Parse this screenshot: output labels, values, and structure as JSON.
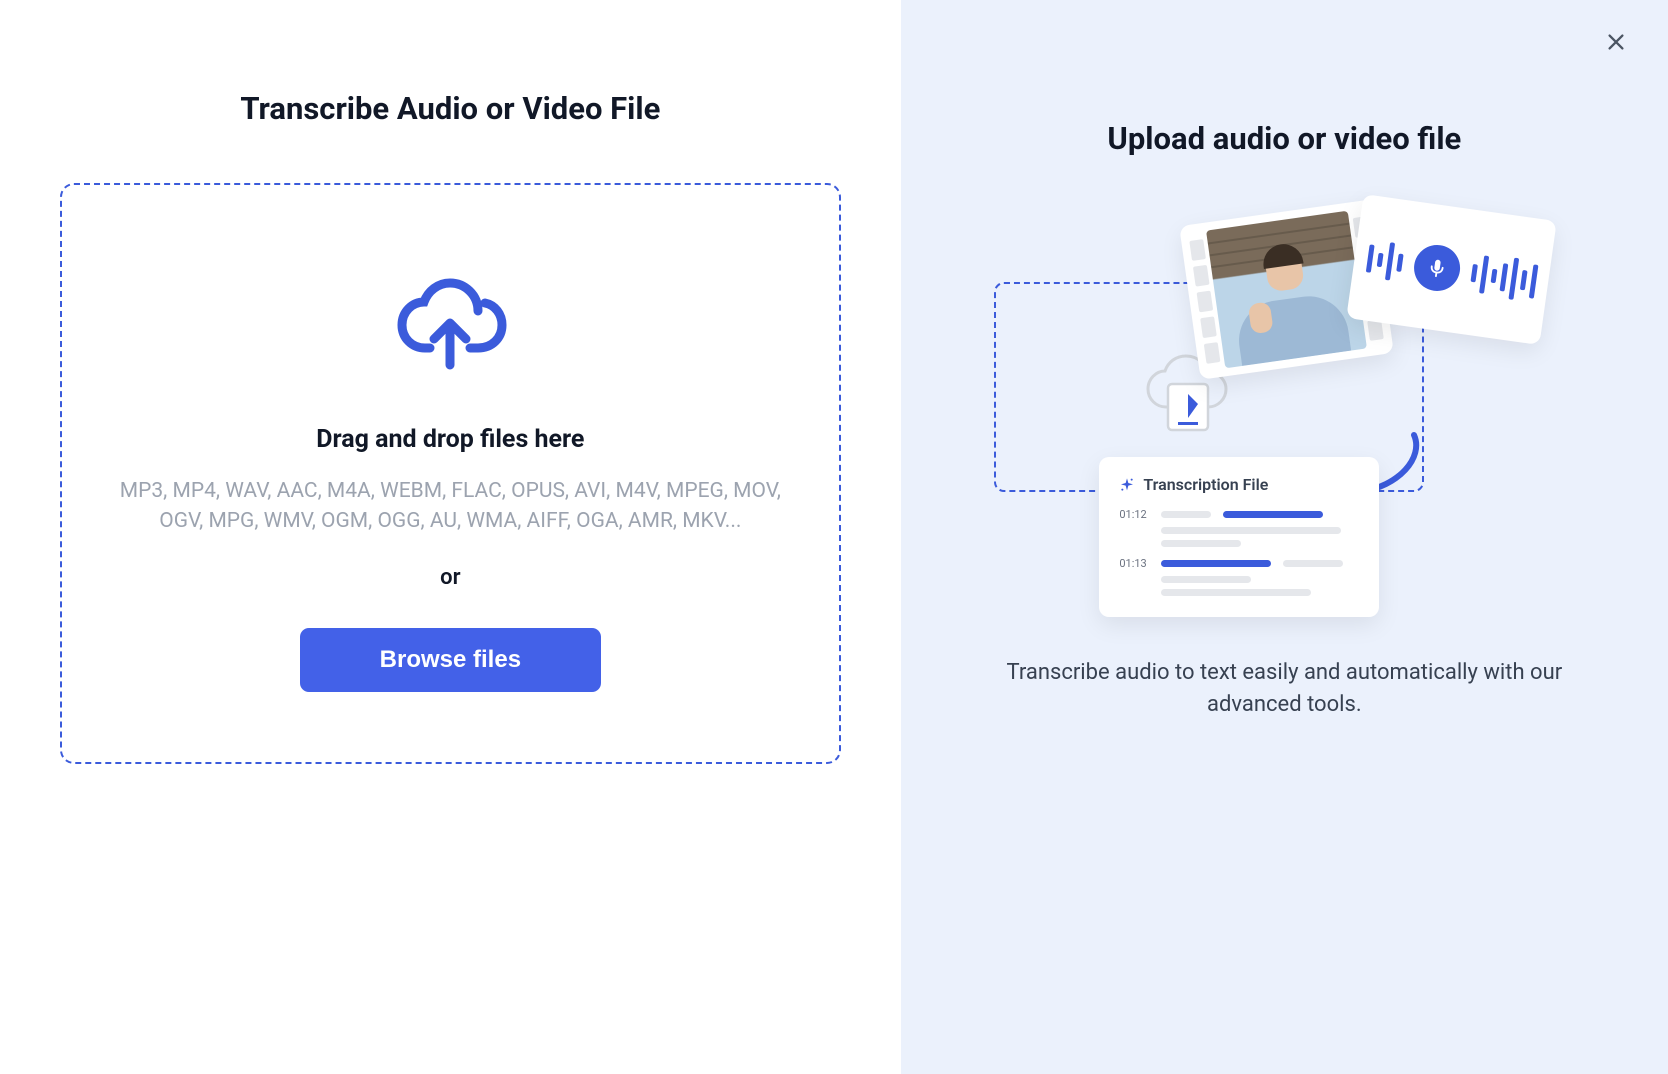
{
  "left": {
    "title": "Transcribe Audio or Video File",
    "drag_text": "Drag and drop files here",
    "formats": "MP3, MP4, WAV, AAC, M4A, WEBM, FLAC, OPUS, AVI, M4V, MPEG, MOV, OGV, MPG, WMV, OGM, OGG, AU, WMA, AIFF, OGA, AMR, MKV...",
    "or": "or",
    "browse_label": "Browse files"
  },
  "right": {
    "title": "Upload audio or video file",
    "transcript_card_title": "Transcription File",
    "timestamp1": "01:12",
    "timestamp2": "01:13",
    "description": "Transcribe audio to text easily and automatically with our advanced tools."
  },
  "colors": {
    "accent": "#3B5BDB",
    "button": "#4361E8"
  }
}
